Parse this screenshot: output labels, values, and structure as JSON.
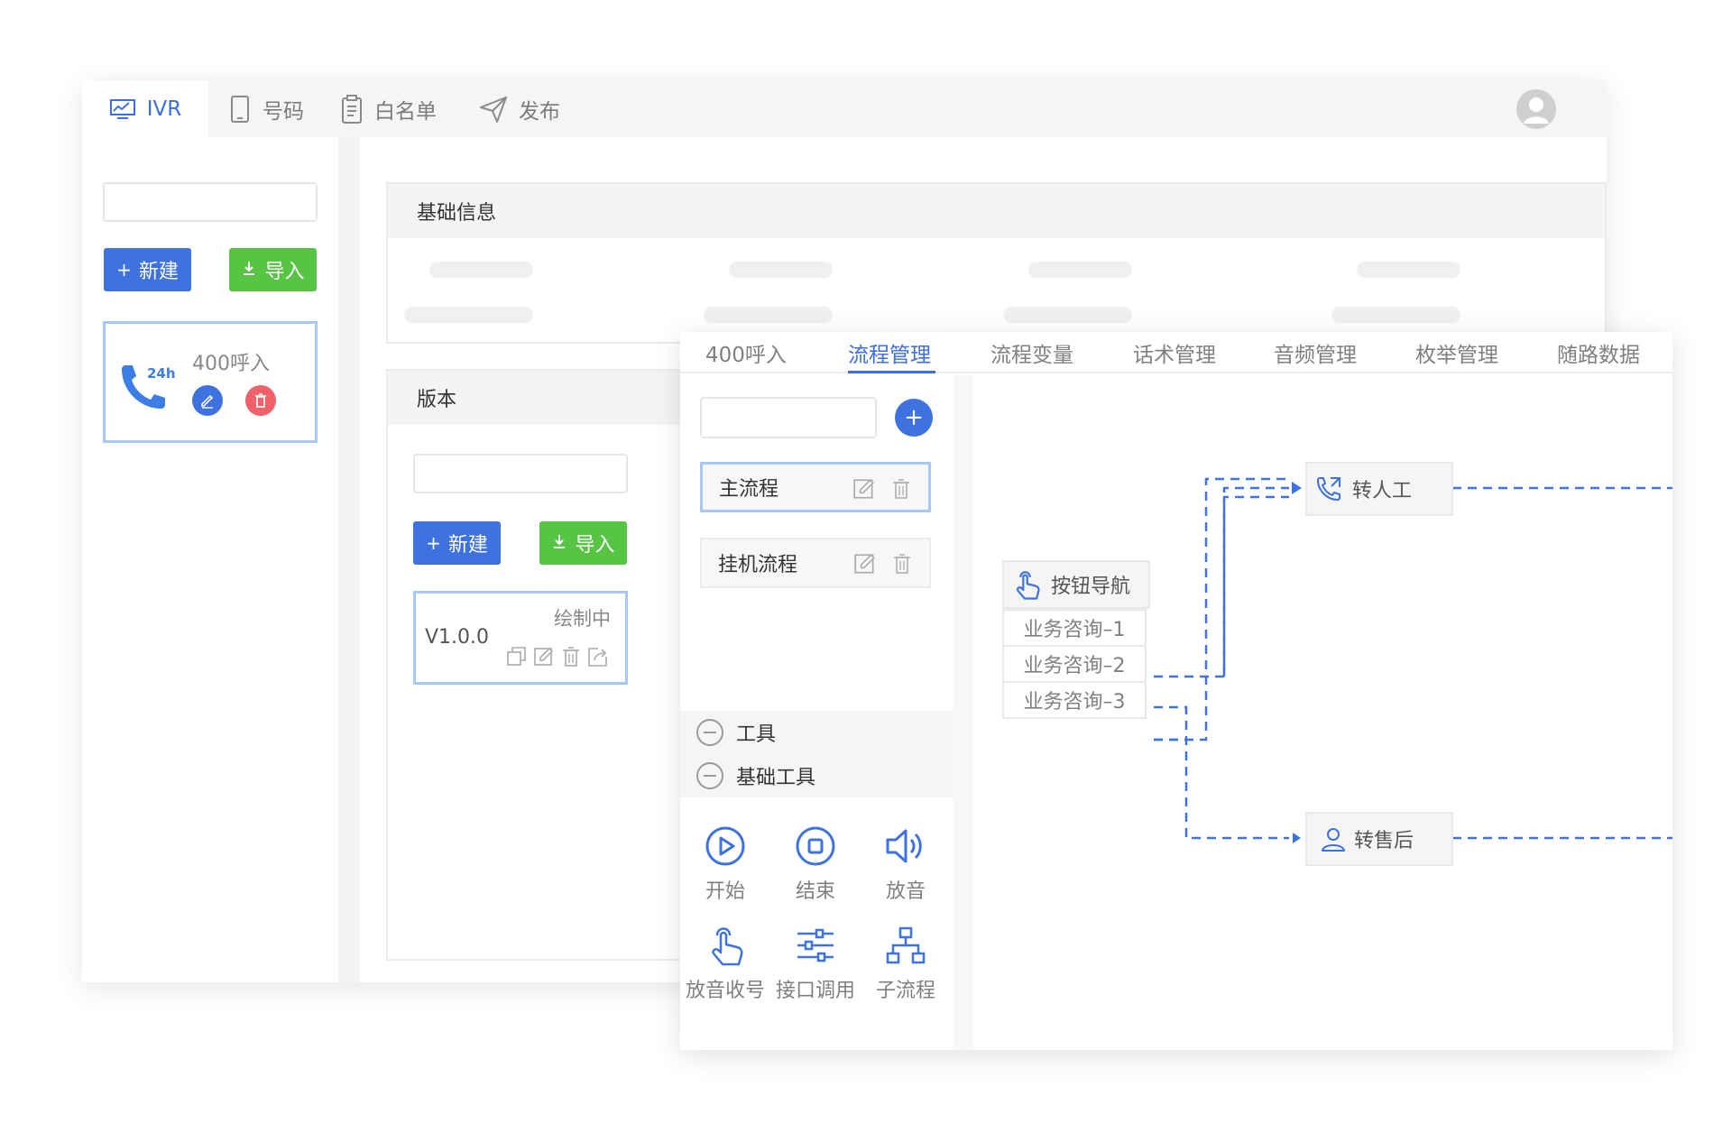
{
  "topnav": {
    "tabs": [
      {
        "label": "IVR",
        "icon": "chart-monitor-icon",
        "active": true
      },
      {
        "label": "号码",
        "icon": "phone-device-icon",
        "active": false
      },
      {
        "label": "白名单",
        "icon": "clipboard-icon",
        "active": false
      },
      {
        "label": "发布",
        "icon": "send-icon",
        "active": false
      }
    ],
    "avatar_icon": "user-avatar-icon"
  },
  "ivr_list": {
    "search_placeholder": "",
    "new_label": "新建",
    "import_label": "导入",
    "cards": [
      {
        "name": "400呼入",
        "badge": "24h",
        "edit_icon": "edit-icon",
        "delete_icon": "trash-icon"
      }
    ]
  },
  "basic_info": {
    "title": "基础信息"
  },
  "version": {
    "title": "版本",
    "search_placeholder": "",
    "new_label": "新建",
    "import_label": "导入",
    "cards": [
      {
        "version": "V1.0.0",
        "status": "绘制中"
      }
    ]
  },
  "editor": {
    "tabs": [
      {
        "label": "400呼入",
        "active": false
      },
      {
        "label": "流程管理",
        "active": true
      },
      {
        "label": "流程变量",
        "active": false
      },
      {
        "label": "话术管理",
        "active": false
      },
      {
        "label": "音频管理",
        "active": false
      },
      {
        "label": "枚举管理",
        "active": false
      },
      {
        "label": "随路数据",
        "active": false
      }
    ],
    "flow_search_placeholder": "",
    "add_icon": "plus-icon",
    "flows": [
      {
        "label": "主流程",
        "selected": true
      },
      {
        "label": "挂机流程",
        "selected": false
      }
    ],
    "groups": [
      {
        "label": "工具"
      },
      {
        "label": "基础工具"
      }
    ],
    "tools": [
      {
        "label": "开始",
        "icon": "play-circle-icon"
      },
      {
        "label": "结束",
        "icon": "stop-circle-icon"
      },
      {
        "label": "放音",
        "icon": "speaker-icon"
      },
      {
        "label": "放音收号",
        "icon": "tap-hand-icon"
      },
      {
        "label": "接口调用",
        "icon": "sliders-icon"
      },
      {
        "label": "子流程",
        "icon": "hierarchy-icon"
      }
    ],
    "canvas": {
      "nav_node": {
        "label": "按钮导航",
        "icon": "tap-hand-icon"
      },
      "options": [
        "业务咨询–1",
        "业务咨询–2",
        "业务咨询–3"
      ],
      "targets": [
        {
          "label": "转人工",
          "icon": "phone-transfer-icon"
        },
        {
          "label": "转售后",
          "icon": "user-icon"
        }
      ]
    }
  },
  "colors": {
    "primary": "#3e72e0",
    "success": "#57c444",
    "danger": "#f0626a",
    "selected_border": "#a8c8f4"
  }
}
